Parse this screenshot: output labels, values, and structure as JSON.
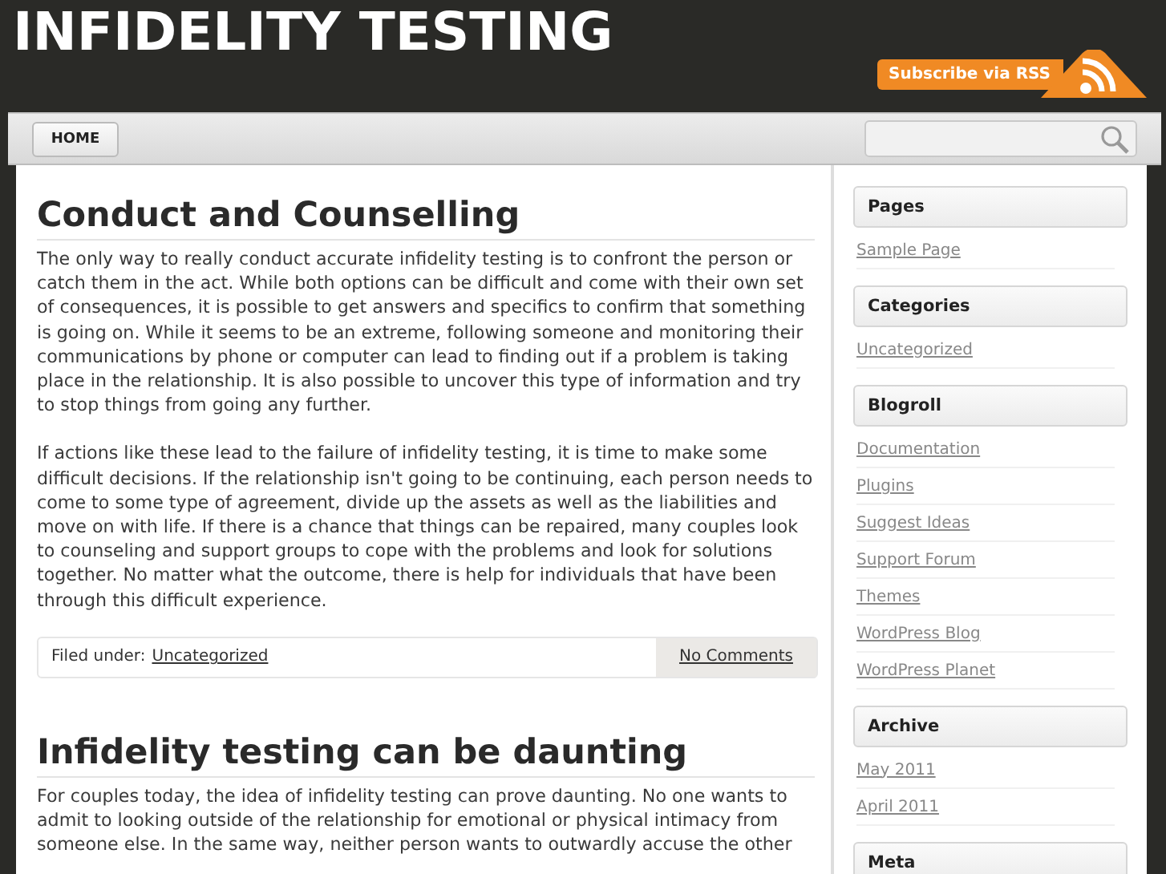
{
  "site_title": "INFIDELITY TESTING",
  "rss_label": "Subscribe via RSS",
  "nav": [
    {
      "label": "HOME",
      "selected": false
    }
  ],
  "posts": [
    {
      "title": "Conduct and Counselling",
      "paragraphs": [
        "The only way to really conduct accurate infidelity testing is to confront the person or catch them in the act. While both options can be difficult and come with their own set of consequences, it is possible to get answers and specifics to confirm that something is going on. While it seems to be an extreme, following someone and monitoring their communications by phone or computer can lead to finding out if a problem is taking place in the relationship. It is also possible to uncover this type of information and try to stop things from going any further.",
        "If actions like these lead to the failure of infidelity testing, it is time to make some difficult decisions. If the relationship isn't going to be continuing, each person needs to come to some type of agreement, divide up the assets as well as the liabilities and move on with life. If there is a chance that things can be repaired, many couples look to counseling and support groups to cope with the problems and look for solutions together. No matter what the outcome, there is help for individuals that have been through this difficult experience."
      ],
      "footer": {
        "filed_label": "Filed under:",
        "category": "Uncategorized",
        "comments": "No Comments"
      }
    },
    {
      "title": "Infidelity testing can be daunting",
      "paragraphs": [
        "For couples today, the idea of infidelity testing can prove daunting. No one wants to admit to looking outside of the relationship for emotional or physical intimacy from someone else. In the same way, neither person wants to outwardly accuse the other"
      ]
    }
  ],
  "sidebar": [
    {
      "title": "Pages",
      "links": [
        "Sample Page"
      ]
    },
    {
      "title": "Categories",
      "links": [
        "Uncategorized"
      ]
    },
    {
      "title": "Blogroll",
      "links": [
        "Documentation",
        "Plugins",
        "Suggest Ideas",
        "Support Forum",
        "Themes",
        "WordPress Blog",
        "WordPress Planet"
      ]
    },
    {
      "title": "Archive",
      "links": [
        "May 2011",
        "April 2011"
      ]
    },
    {
      "title": "Meta"
    }
  ]
}
